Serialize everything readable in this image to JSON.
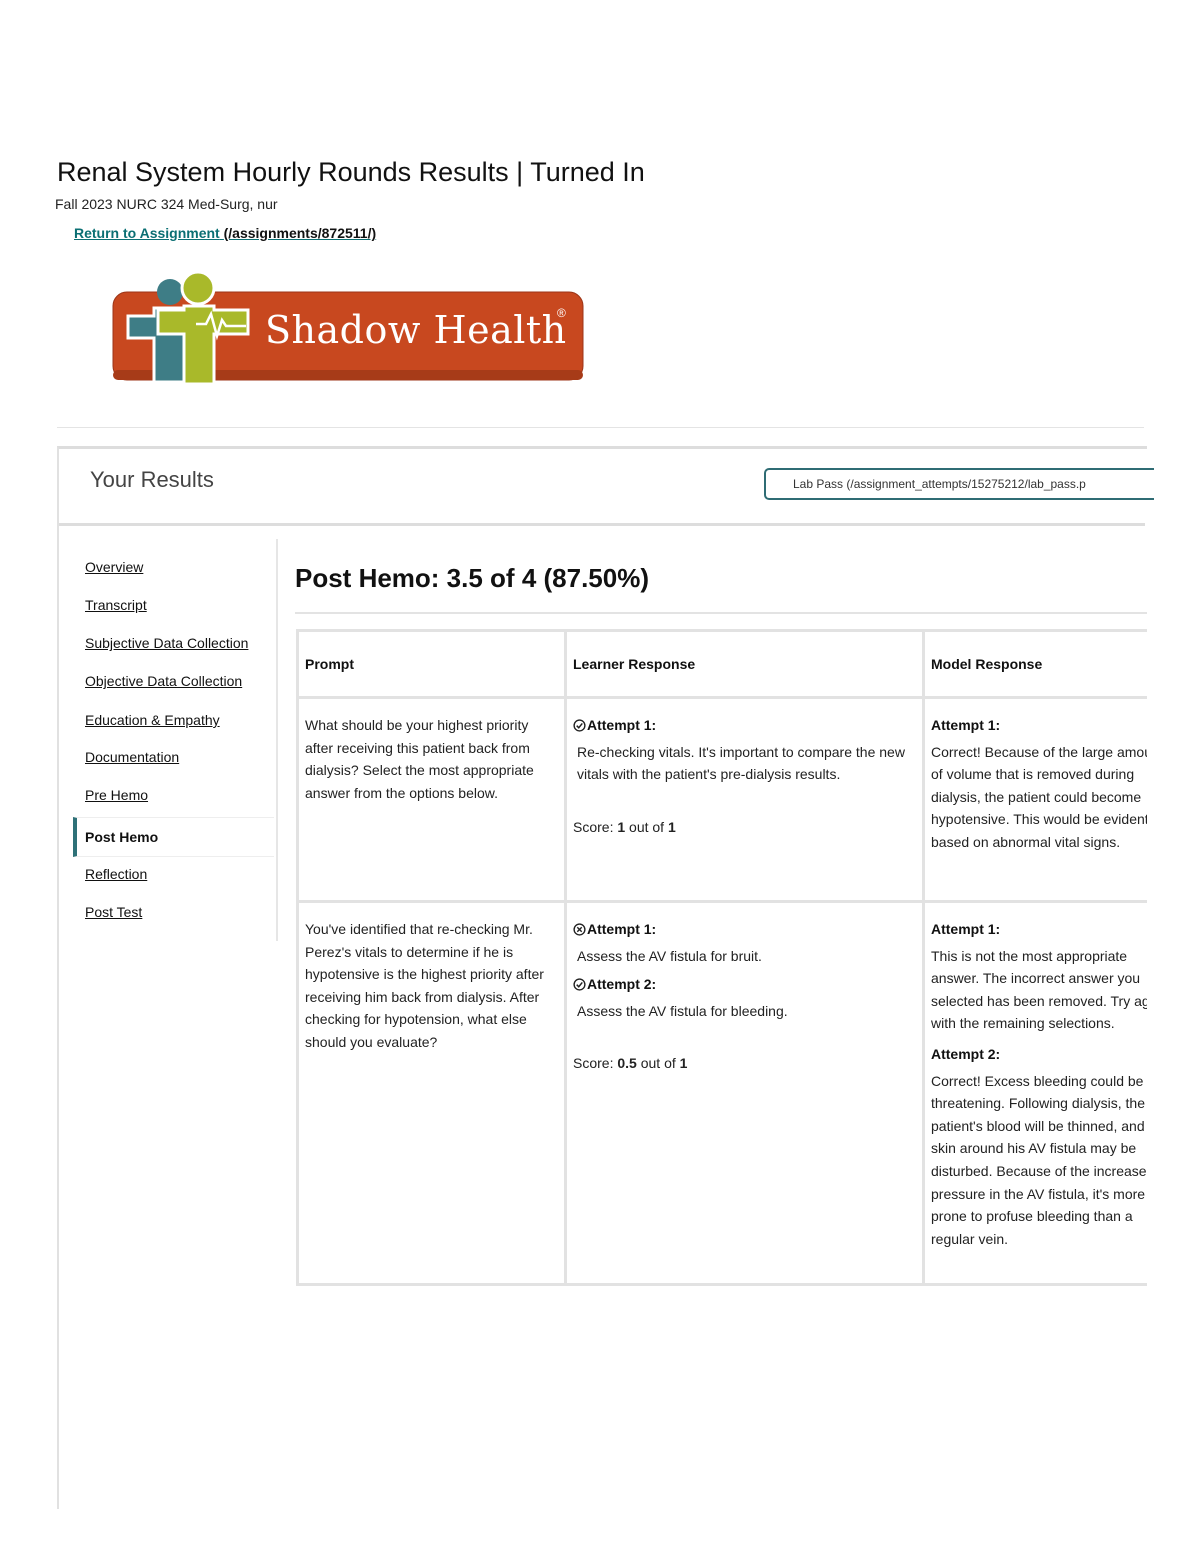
{
  "header": {
    "title": "Renal System Hourly Rounds Results | Turned In",
    "course": "Fall 2023 NURC 324 Med-Surg, nur",
    "return_label": "Return to Assignment",
    "return_path": "(/assignments/872511/)"
  },
  "logo": {
    "text": "Shadow Health",
    "reg": "®"
  },
  "results": {
    "title": "Your Results",
    "lab_pass": "Lab Pass (/assignment_attempts/15275212/lab_pass.p"
  },
  "nav": {
    "items": [
      {
        "label": "Overview"
      },
      {
        "label": "Transcript"
      },
      {
        "label": "Subjective Data Collection"
      },
      {
        "label": "Objective Data Collection"
      },
      {
        "label": "Education & Empathy"
      },
      {
        "label": "Documentation"
      },
      {
        "label": "Pre Hemo"
      },
      {
        "label": "Post Hemo"
      },
      {
        "label": "Reflection"
      },
      {
        "label": "Post Test"
      }
    ],
    "active": "Post Hemo"
  },
  "section": {
    "title": "Post Hemo: 3.5 of 4 (87.50%)"
  },
  "table": {
    "headers": [
      "Prompt",
      "Learner Response",
      "Model Response"
    ],
    "rows": [
      {
        "prompt": "What should be your highest priority after receiving this patient back from dialysis? Select the most appropriate answer from the options below.",
        "attempts": [
          {
            "label": "Attempt 1:",
            "text": "Re-checking vitals. It's important to compare the new vitals with the patient's pre-dialysis results.",
            "status": "correct"
          }
        ],
        "score_prefix": "Score: ",
        "score": "1",
        "score_mid": " out of ",
        "score_max": "1",
        "model": [
          {
            "label": "Attempt 1:",
            "text": "Correct! Because of the large amount of volume that is removed during dialysis, the patient could become hypotensive. This would be evident based on abnormal vital signs."
          }
        ]
      },
      {
        "prompt": "You've identified that re-checking Mr. Perez's vitals to determine if he is hypotensive is the highest priority after receiving him back from dialysis. After checking for hypotension, what else should you evaluate?",
        "attempts": [
          {
            "label": "Attempt 1:",
            "text": "Assess the AV fistula for bruit.",
            "status": "incorrect"
          },
          {
            "label": "Attempt 2:",
            "text": "Assess the AV fistula for bleeding.",
            "status": "correct"
          }
        ],
        "score_prefix": "Score: ",
        "score": "0.5",
        "score_mid": " out of ",
        "score_max": "1",
        "model": [
          {
            "label": "Attempt 1:",
            "text": "This is not the most appropriate answer. The incorrect answer you selected has been removed. Try again with the remaining selections."
          },
          {
            "label": "Attempt 2:",
            "text": "Correct! Excess bleeding could be life-threatening. Following dialysis, the patient's blood will be thinned, and the skin around his AV fistula may be disturbed. Because of the increased pressure in the AV fistula, it's more prone to profuse bleeding than a regular vein."
          }
        ]
      }
    ]
  },
  "colors": {
    "link": "#0b6f73",
    "active_nav": "#2e7178",
    "logo_orange": "#c8481f",
    "logo_figure": "#a9b92a",
    "logo_shadow": "#3e7d86"
  }
}
